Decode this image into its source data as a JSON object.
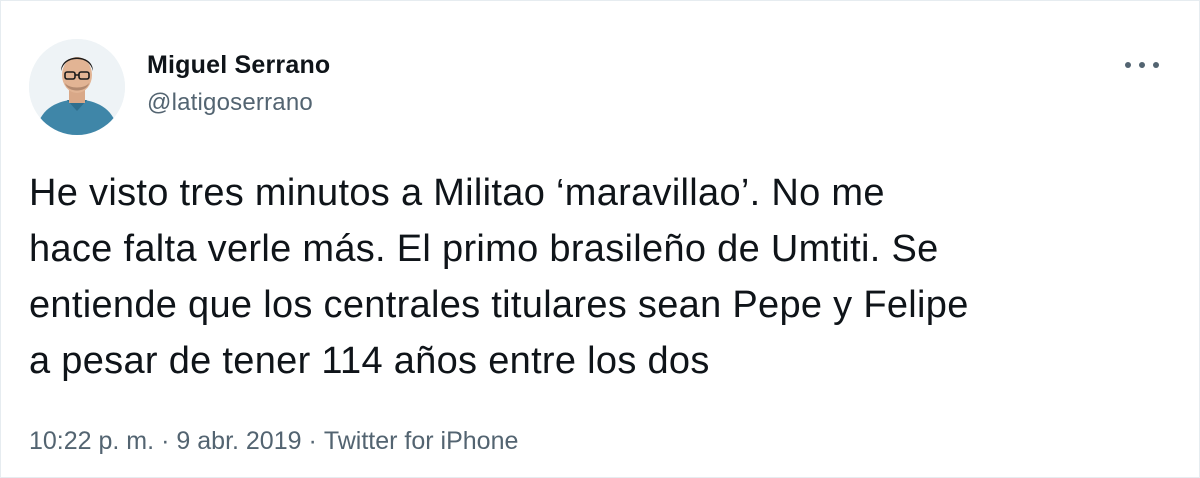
{
  "user": {
    "display_name": "Miguel Serrano",
    "handle": "@latigoserrano",
    "avatar_icon": "profile-photo"
  },
  "more_icon": "more-dots-icon",
  "tweet": {
    "lines": [
      "He visto tres minutos a Militao ‘maravillao’. No me",
      "hace falta verle más. El primo brasileño de Umtiti. Se",
      "entiende que los centrales titulares sean Pepe y Felipe",
      "a pesar de tener 114 años entre los dos"
    ]
  },
  "meta": {
    "time": "10:22 p. m.",
    "separator": "·",
    "date": "9 abr. 2019",
    "source": "Twitter for iPhone"
  },
  "colors": {
    "text": "#0f1419",
    "secondary": "#536471",
    "border": "#e6ecf0"
  }
}
